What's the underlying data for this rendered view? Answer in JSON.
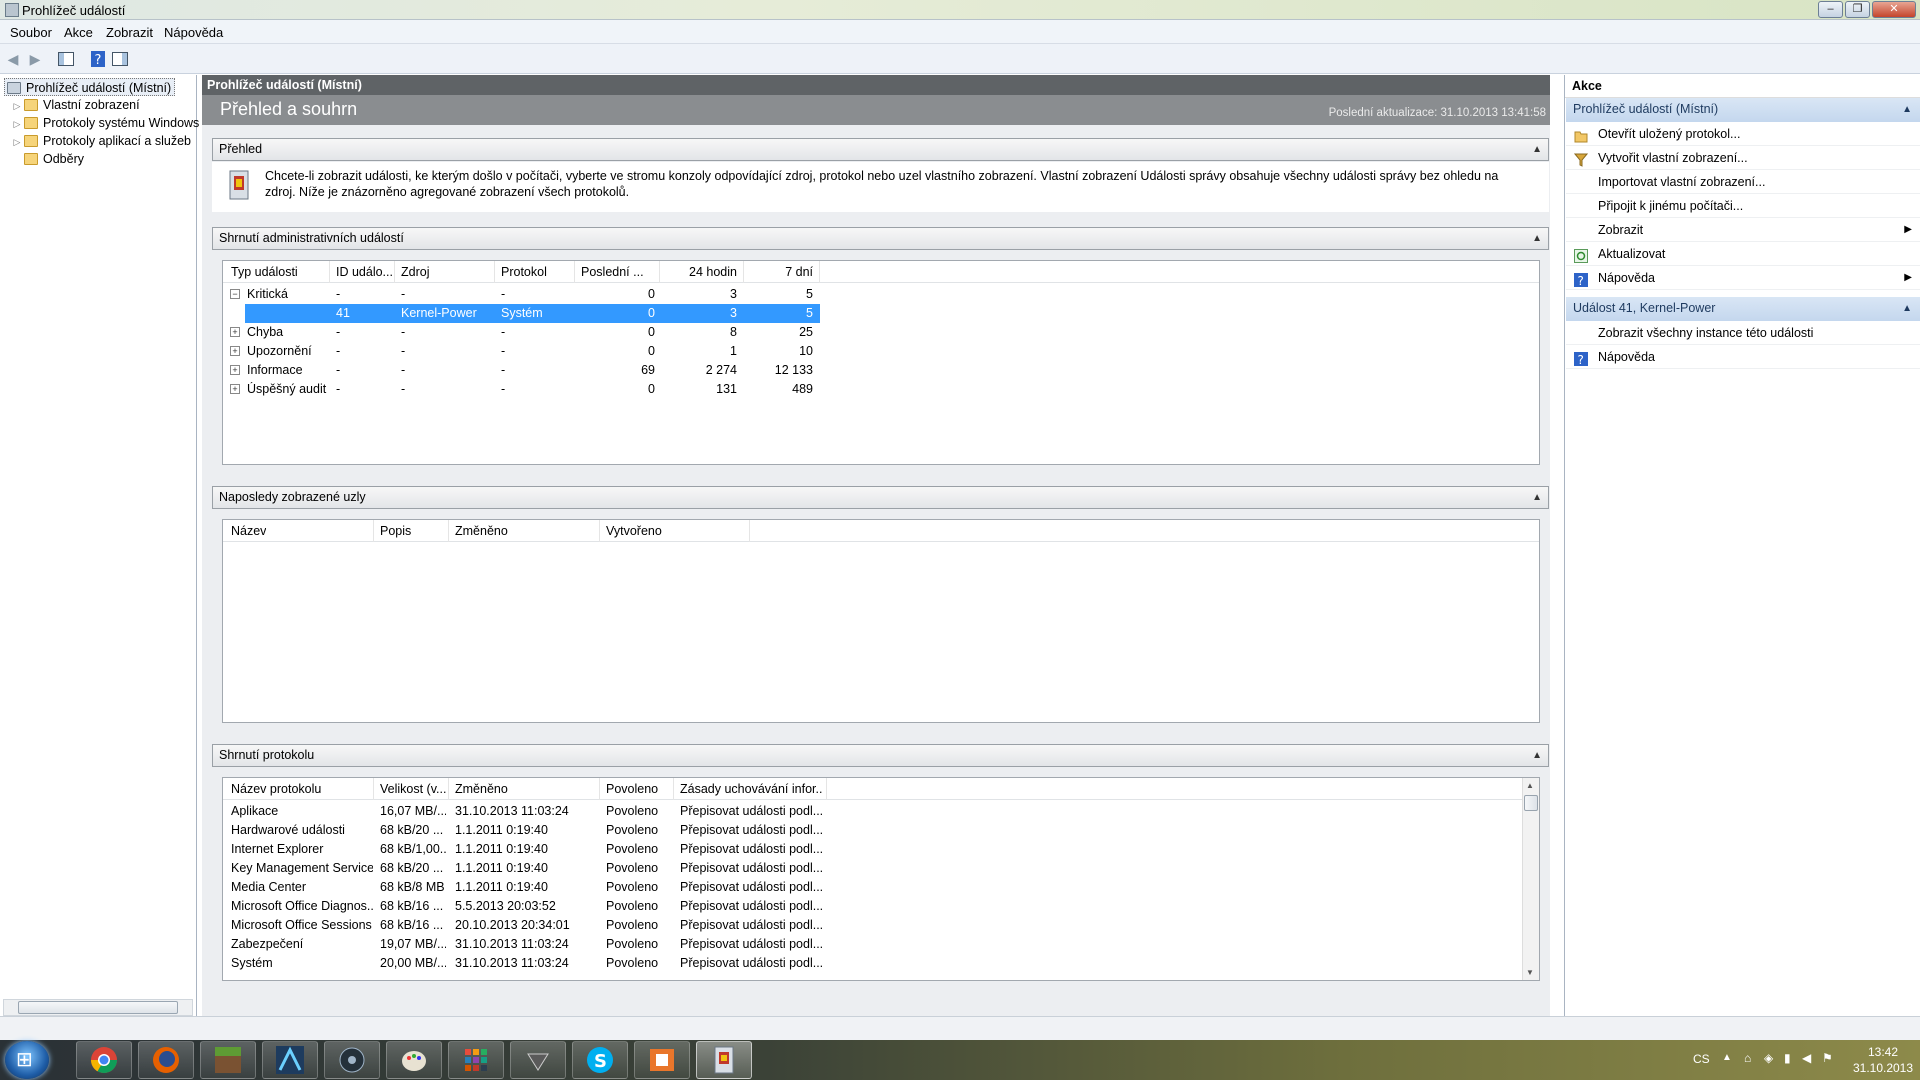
{
  "window": {
    "title": "Prohlížeč událostí",
    "controls": [
      "–",
      "❐",
      "✕"
    ]
  },
  "menu": [
    "Soubor",
    "Akce",
    "Zobrazit",
    "Nápověda"
  ],
  "tree": {
    "root": "Prohlížeč událostí (Místní)",
    "items": [
      "Vlastní zobrazení",
      "Protokoly systému Windows",
      "Protokoly aplikací a služeb",
      "Odběry"
    ]
  },
  "center": {
    "pane_title": "Prohlížeč událostí (Místní)",
    "overview_title": "Přehled a souhrn",
    "last_update": "Poslední aktualizace: 31.10.2013 13:41:58",
    "sections": {
      "overview": "Přehled",
      "admin": "Shrnutí administrativních událostí",
      "recent": "Naposledy zobrazené uzly",
      "logs": "Shrnutí protokolu"
    },
    "intro_text": "Chcete-li zobrazit události, ke kterým došlo v počítači, vyberte ve stromu konzoly odpovídající zdroj, protokol nebo uzel vlastního zobrazení. Vlastní zobrazení Události správy obsahuje všechny události správy bez ohledu na zdroj. Níže je znázorněno agregované zobrazení všech protokolů.",
    "admin_columns": [
      "Typ události",
      "ID událo...",
      "Zdroj",
      "Protokol",
      "Poslední ...",
      "24 hodin",
      "7 dní"
    ],
    "admin_rows": [
      {
        "type": "Kritická",
        "id": "-",
        "src": "-",
        "log": "-",
        "last": "0",
        "h24": "3",
        "d7": "5",
        "exp": "⊟"
      },
      {
        "type": "",
        "id": "41",
        "src": "Kernel-Power",
        "log": "Systém",
        "last": "0",
        "h24": "3",
        "d7": "5",
        "exp": ""
      },
      {
        "type": "Chyba",
        "id": "-",
        "src": "-",
        "log": "-",
        "last": "0",
        "h24": "8",
        "d7": "25",
        "exp": "⊞"
      },
      {
        "type": "Upozornění",
        "id": "-",
        "src": "-",
        "log": "-",
        "last": "0",
        "h24": "1",
        "d7": "10",
        "exp": "⊞"
      },
      {
        "type": "Informace",
        "id": "-",
        "src": "-",
        "log": "-",
        "last": "69",
        "h24": "2 274",
        "d7": "12 133",
        "exp": "⊞"
      },
      {
        "type": "Úspěšný audit",
        "id": "-",
        "src": "-",
        "log": "-",
        "last": "0",
        "h24": "131",
        "d7": "489",
        "exp": "⊞"
      }
    ],
    "recent_columns": [
      "Název",
      "Popis",
      "Změněno",
      "Vytvořeno"
    ],
    "log_columns": [
      "Název protokolu",
      "Velikost (v...",
      "Změněno",
      "Povoleno",
      "Zásady uchovávání infor..."
    ],
    "log_rows": [
      {
        "name": "Aplikace",
        "size": "16,07 MB/...",
        "changed": "31.10.2013 11:03:24",
        "enabled": "Povoleno",
        "policy": "Přepisovat události podl..."
      },
      {
        "name": "Hardwarové události",
        "size": "68 kB/20 ...",
        "changed": "1.1.2011 0:19:40",
        "enabled": "Povoleno",
        "policy": "Přepisovat události podl..."
      },
      {
        "name": "Internet Explorer",
        "size": "68 kB/1,00...",
        "changed": "1.1.2011 0:19:40",
        "enabled": "Povoleno",
        "policy": "Přepisovat události podl..."
      },
      {
        "name": "Key Management Service",
        "size": "68 kB/20 ...",
        "changed": "1.1.2011 0:19:40",
        "enabled": "Povoleno",
        "policy": "Přepisovat události podl..."
      },
      {
        "name": "Media Center",
        "size": "68 kB/8 MB",
        "changed": "1.1.2011 0:19:40",
        "enabled": "Povoleno",
        "policy": "Přepisovat události podl..."
      },
      {
        "name": "Microsoft Office Diagnos...",
        "size": "68 kB/16 ...",
        "changed": "5.5.2013 20:03:52",
        "enabled": "Povoleno",
        "policy": "Přepisovat události podl..."
      },
      {
        "name": "Microsoft Office Sessions",
        "size": "68 kB/16 ...",
        "changed": "20.10.2013 20:34:01",
        "enabled": "Povoleno",
        "policy": "Přepisovat události podl..."
      },
      {
        "name": "Zabezpečení",
        "size": "19,07 MB/...",
        "changed": "31.10.2013 11:03:24",
        "enabled": "Povoleno",
        "policy": "Přepisovat události podl..."
      },
      {
        "name": "Systém",
        "size": "20,00 MB/...",
        "changed": "31.10.2013 11:03:24",
        "enabled": "Povoleno",
        "policy": "Přepisovat události podl..."
      }
    ]
  },
  "actions": {
    "title": "Akce",
    "group1": "Prohlížeč událostí (Místní)",
    "items1": [
      "Otevřít uložený protokol...",
      "Vytvořit vlastní zobrazení...",
      "Importovat vlastní zobrazení...",
      "Připojit k jinému počítači...",
      "Zobrazit",
      "Aktualizovat",
      "Nápověda"
    ],
    "group2": "Událost 41, Kernel-Power",
    "items2": [
      "Zobrazit všechny instance této události",
      "Nápověda"
    ]
  },
  "taskbar": {
    "lang": "CS",
    "time": "13:42",
    "date": "31.10.2013"
  }
}
